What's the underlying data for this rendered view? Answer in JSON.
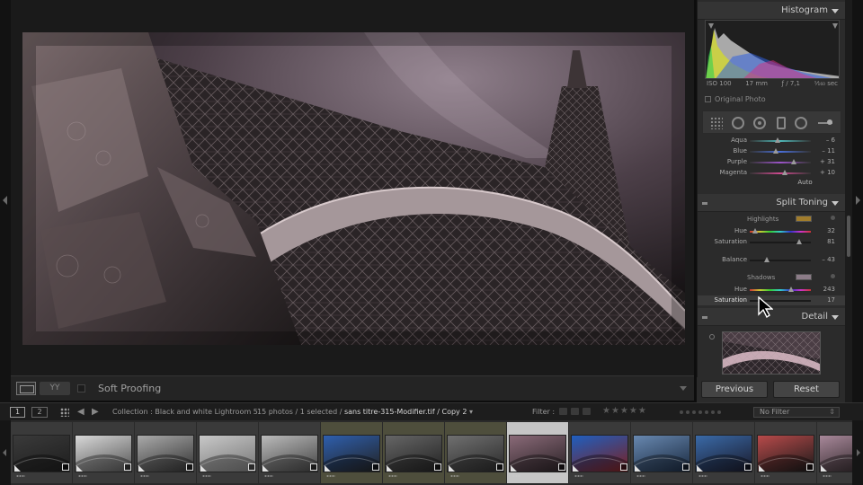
{
  "toolbar": {
    "soft_proofing_label": "Soft Proofing",
    "yy_label": "YY"
  },
  "histogram": {
    "title": "Histogram",
    "iso": "ISO 100",
    "focal": "17 mm",
    "aperture": "ƒ / 7,1",
    "shutter": "¹⁄₁₆₀ sec",
    "original_photo_label": "Original Photo"
  },
  "hsl": {
    "rows": [
      {
        "label": "Aqua",
        "value": "– 6",
        "pos": 0.46
      },
      {
        "label": "Blue",
        "value": "– 11",
        "pos": 0.43
      },
      {
        "label": "Purple",
        "value": "+ 31",
        "pos": 0.72
      },
      {
        "label": "Magenta",
        "value": "+ 10",
        "pos": 0.57
      }
    ],
    "auto_label": "Auto"
  },
  "split_toning": {
    "title": "Split Toning",
    "highlights_label": "Highlights",
    "highlights_color": "#a07c2c",
    "highlights_rows": [
      {
        "label": "Hue",
        "value": "32",
        "pos": 0.09
      },
      {
        "label": "Saturation",
        "value": "81",
        "pos": 0.81
      }
    ],
    "balance_row": {
      "label": "Balance",
      "value": "– 43",
      "pos": 0.28
    },
    "shadows_label": "Shadows",
    "shadows_color": "#8c7c88",
    "shadows_rows": [
      {
        "label": "Hue",
        "value": "243",
        "pos": 0.68
      },
      {
        "label": "Saturation",
        "value": "17",
        "pos": 0.17
      }
    ]
  },
  "detail": {
    "title": "Detail"
  },
  "buttons": {
    "previous": "Previous",
    "reset": "Reset"
  },
  "filmstrip_bar": {
    "view1": "1",
    "view2": "2",
    "collection": "Collection : Black and white Lightroom 5",
    "count": "15 photos / 1 selected / ",
    "filename": "sans titre-315-Modifier.tif / Copy 2",
    "filter_label": "Filter :",
    "stars": "★★★★★",
    "no_filter": "No Filter"
  },
  "filmstrip": {
    "thumbs": [
      {
        "style": "dark-partial",
        "tint": false,
        "selected": false
      },
      {
        "style": "gray-sky",
        "tint": false,
        "selected": false
      },
      {
        "style": "gray-pier",
        "tint": false,
        "selected": false
      },
      {
        "style": "gray-soft",
        "tint": false,
        "selected": false
      },
      {
        "style": "gray-mist",
        "tint": false,
        "selected": false
      },
      {
        "style": "blue-tower",
        "tint": true,
        "selected": false
      },
      {
        "style": "dark-arch",
        "tint": true,
        "selected": false
      },
      {
        "style": "dark-arch2",
        "tint": true,
        "selected": false
      },
      {
        "style": "pink-arch",
        "tint": false,
        "selected": true
      },
      {
        "style": "blue-red",
        "tint": false,
        "selected": false
      },
      {
        "style": "blue-steel",
        "tint": false,
        "selected": false
      },
      {
        "style": "blue-night",
        "tint": false,
        "selected": false
      },
      {
        "style": "red-city",
        "tint": false,
        "selected": false
      },
      {
        "style": "pink-dusk",
        "tint": false,
        "selected": false
      }
    ]
  }
}
